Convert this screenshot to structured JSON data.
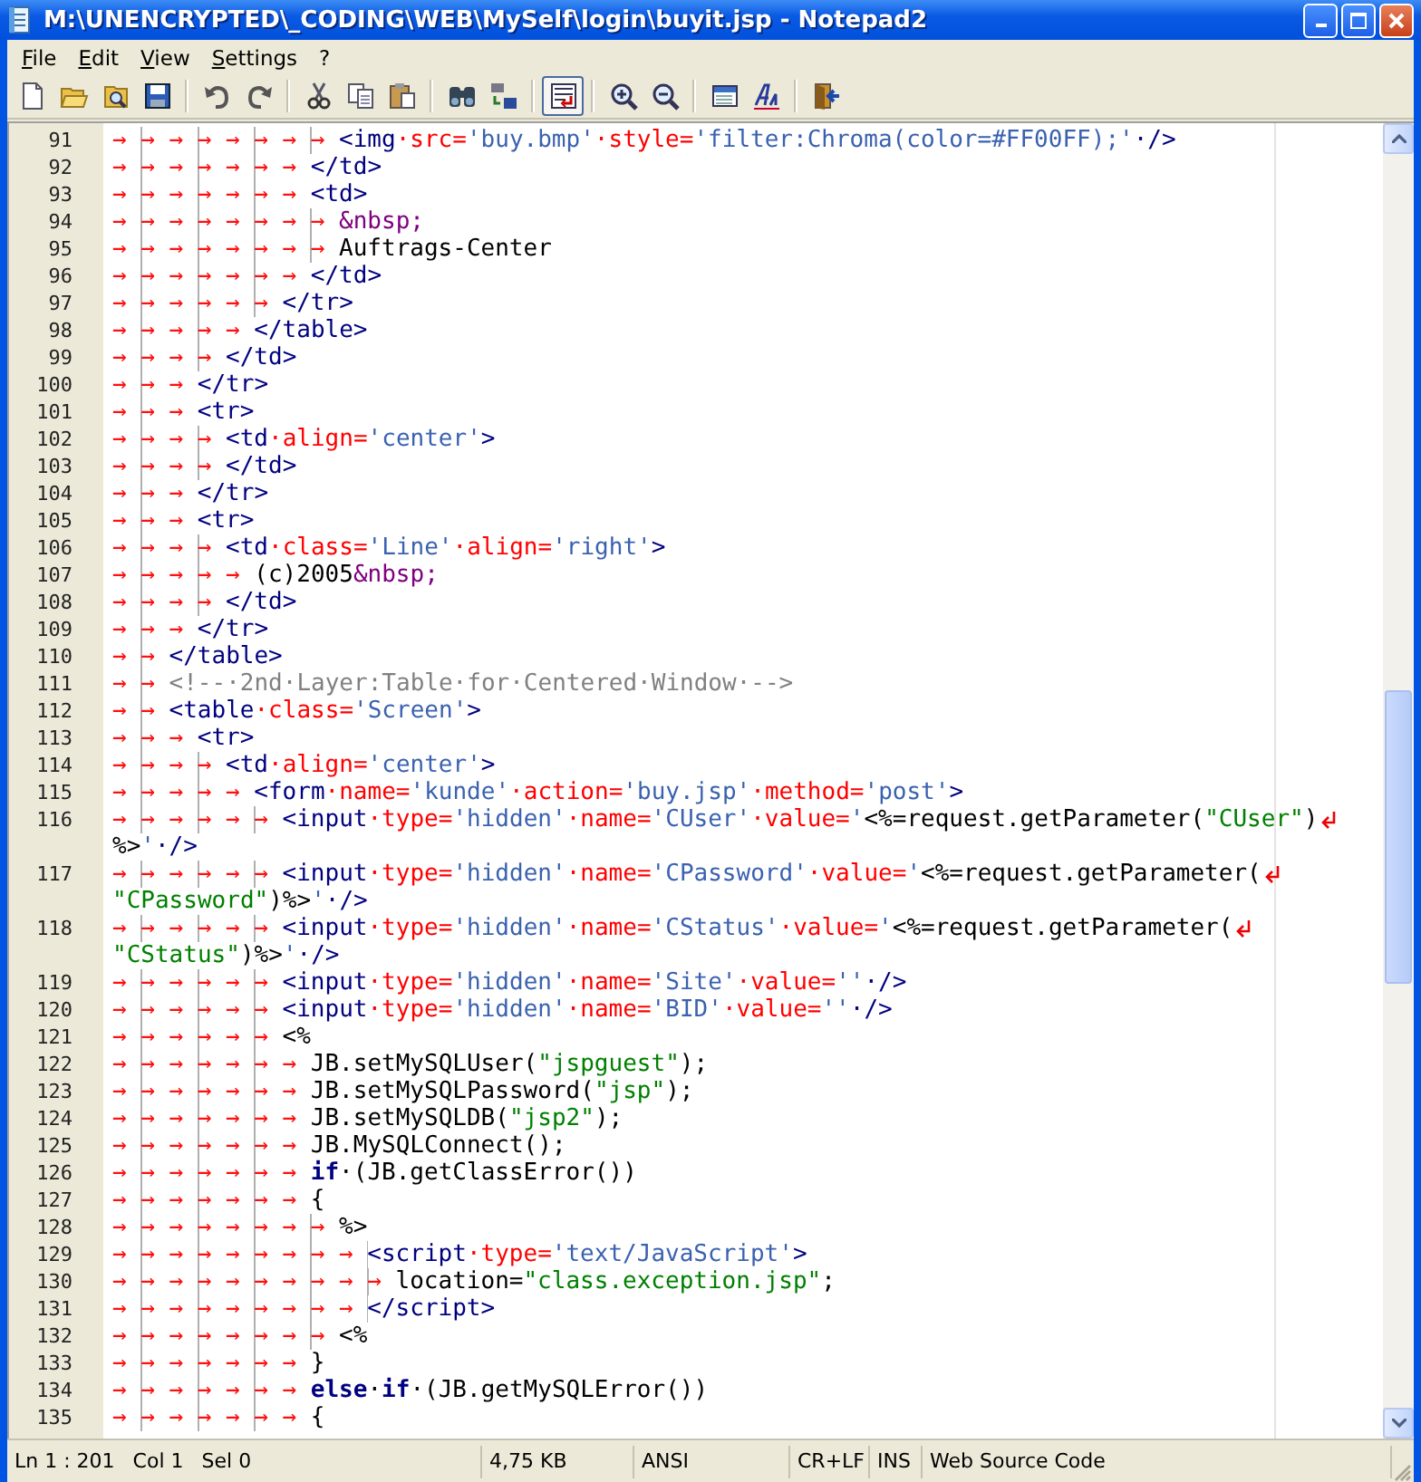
{
  "window": {
    "title": "M:\\UNENCRYPTED\\_CODING\\WEB\\MySelf\\login\\buyit.jsp - Notepad2"
  },
  "menu": [
    "File",
    "Edit",
    "View",
    "Settings",
    "?"
  ],
  "toolbar": {
    "groups": [
      [
        {
          "kind": "new",
          "pressed": false
        },
        {
          "kind": "open",
          "pressed": false
        },
        {
          "kind": "browse",
          "pressed": false
        },
        {
          "kind": "save",
          "pressed": false
        }
      ],
      [
        {
          "kind": "undo",
          "pressed": false
        },
        {
          "kind": "redo",
          "pressed": false
        }
      ],
      [
        {
          "kind": "cut",
          "pressed": false
        },
        {
          "kind": "copy",
          "pressed": false
        },
        {
          "kind": "paste",
          "pressed": false
        }
      ],
      [
        {
          "kind": "find",
          "pressed": false
        },
        {
          "kind": "replace",
          "pressed": false
        }
      ],
      [
        {
          "kind": "wordwrap",
          "pressed": true
        }
      ],
      [
        {
          "kind": "zoomin",
          "pressed": false
        },
        {
          "kind": "zoomout",
          "pressed": false
        }
      ],
      [
        {
          "kind": "scheme",
          "pressed": false
        },
        {
          "kind": "font",
          "pressed": false
        }
      ],
      [
        {
          "kind": "exit",
          "pressed": false
        }
      ]
    ]
  },
  "editor": {
    "lines": [
      {
        "number": "91",
        "indent": "→→→→→→→→",
        "wrapped_parts": [
          [
            {
              "kind": "tag",
              "text": "<img"
            },
            {
              "kind": "attr",
              "text": "·src="
            },
            {
              "kind": "val",
              "text": "'buy.bmp'"
            },
            {
              "kind": "attr",
              "text": "·style="
            },
            {
              "kind": "val",
              "text": "'filter:Chroma(color=#FF00FF);'"
            },
            {
              "kind": "tag",
              "text": "·/>"
            }
          ]
        ]
      },
      {
        "number": "92",
        "indent": "→→→→→→→",
        "wrapped_parts": [
          [
            {
              "kind": "tag",
              "text": "</td>"
            }
          ]
        ]
      },
      {
        "number": "93",
        "indent": "→→→→→→→",
        "wrapped_parts": [
          [
            {
              "kind": "tag",
              "text": "<td>"
            }
          ]
        ]
      },
      {
        "number": "94",
        "indent": "→→→→→→→→",
        "wrapped_parts": [
          [
            {
              "kind": "ent",
              "text": "&nbsp;"
            }
          ]
        ]
      },
      {
        "number": "95",
        "indent": "→→→→→→→→",
        "wrapped_parts": [
          [
            {
              "kind": "text",
              "text": "Auftrags-Center"
            }
          ]
        ]
      },
      {
        "number": "96",
        "indent": "→→→→→→→",
        "wrapped_parts": [
          [
            {
              "kind": "tag",
              "text": "</td>"
            }
          ]
        ]
      },
      {
        "number": "97",
        "indent": "→→→→→→",
        "wrapped_parts": [
          [
            {
              "kind": "tag",
              "text": "</tr>"
            }
          ]
        ]
      },
      {
        "number": "98",
        "indent": "→→→→→",
        "wrapped_parts": [
          [
            {
              "kind": "tag",
              "text": "</table>"
            }
          ]
        ]
      },
      {
        "number": "99",
        "indent": "→→→→",
        "wrapped_parts": [
          [
            {
              "kind": "tag",
              "text": "</td>"
            }
          ]
        ]
      },
      {
        "number": "100",
        "indent": "→→→",
        "wrapped_parts": [
          [
            {
              "kind": "tag",
              "text": "</tr>"
            }
          ]
        ]
      },
      {
        "number": "101",
        "indent": "→→→",
        "wrapped_parts": [
          [
            {
              "kind": "tag",
              "text": "<tr>"
            }
          ]
        ]
      },
      {
        "number": "102",
        "indent": "→→→→",
        "wrapped_parts": [
          [
            {
              "kind": "tag",
              "text": "<td"
            },
            {
              "kind": "attr",
              "text": "·align="
            },
            {
              "kind": "val",
              "text": "'center'"
            },
            {
              "kind": "tag",
              "text": ">"
            }
          ]
        ]
      },
      {
        "number": "103",
        "indent": "→→→→",
        "wrapped_parts": [
          [
            {
              "kind": "tag",
              "text": "</td>"
            }
          ]
        ]
      },
      {
        "number": "104",
        "indent": "→→→",
        "wrapped_parts": [
          [
            {
              "kind": "tag",
              "text": "</tr>"
            }
          ]
        ]
      },
      {
        "number": "105",
        "indent": "→→→",
        "wrapped_parts": [
          [
            {
              "kind": "tag",
              "text": "<tr>"
            }
          ]
        ]
      },
      {
        "number": "106",
        "indent": "→→→→",
        "wrapped_parts": [
          [
            {
              "kind": "tag",
              "text": "<td"
            },
            {
              "kind": "attr",
              "text": "·class="
            },
            {
              "kind": "val",
              "text": "'Line'"
            },
            {
              "kind": "attr",
              "text": "·align="
            },
            {
              "kind": "val",
              "text": "'right'"
            },
            {
              "kind": "tag",
              "text": ">"
            }
          ]
        ]
      },
      {
        "number": "107",
        "indent": "→→→→→",
        "wrapped_parts": [
          [
            {
              "kind": "text",
              "text": "(c)2005"
            },
            {
              "kind": "ent",
              "text": "&nbsp;"
            }
          ]
        ]
      },
      {
        "number": "108",
        "indent": "→→→→",
        "wrapped_parts": [
          [
            {
              "kind": "tag",
              "text": "</td>"
            }
          ]
        ]
      },
      {
        "number": "109",
        "indent": "→→→",
        "wrapped_parts": [
          [
            {
              "kind": "tag",
              "text": "</tr>"
            }
          ]
        ]
      },
      {
        "number": "110",
        "indent": "→→",
        "wrapped_parts": [
          [
            {
              "kind": "tag",
              "text": "</table>"
            }
          ]
        ]
      },
      {
        "number": "111",
        "indent": "→→",
        "wrapped_parts": [
          [
            {
              "kind": "cmt",
              "text": "<!--·2nd·Layer:Table·for·Centered·Window·-->"
            }
          ]
        ]
      },
      {
        "number": "112",
        "indent": "→→",
        "wrapped_parts": [
          [
            {
              "kind": "tag",
              "text": "<table"
            },
            {
              "kind": "attr",
              "text": "·class="
            },
            {
              "kind": "val",
              "text": "'Screen'"
            },
            {
              "kind": "tag",
              "text": ">"
            }
          ]
        ]
      },
      {
        "number": "113",
        "indent": "→→→",
        "wrapped_parts": [
          [
            {
              "kind": "tag",
              "text": "<tr>"
            }
          ]
        ]
      },
      {
        "number": "114",
        "indent": "→→→→",
        "wrapped_parts": [
          [
            {
              "kind": "tag",
              "text": "<td"
            },
            {
              "kind": "attr",
              "text": "·align="
            },
            {
              "kind": "val",
              "text": "'center'"
            },
            {
              "kind": "tag",
              "text": ">"
            }
          ]
        ]
      },
      {
        "number": "115",
        "indent": "→→→→→",
        "wrapped_parts": [
          [
            {
              "kind": "tag",
              "text": "<form"
            },
            {
              "kind": "attr",
              "text": "·name="
            },
            {
              "kind": "val",
              "text": "'kunde'"
            },
            {
              "kind": "attr",
              "text": "·action="
            },
            {
              "kind": "val",
              "text": "'buy.jsp'"
            },
            {
              "kind": "attr",
              "text": "·method="
            },
            {
              "kind": "val",
              "text": "'post'"
            },
            {
              "kind": "tag",
              "text": ">"
            }
          ]
        ]
      },
      {
        "number": "116",
        "indent": "→→→→→→",
        "wrapped_parts": [
          [
            {
              "kind": "tag",
              "text": "<input"
            },
            {
              "kind": "attr",
              "text": "·type="
            },
            {
              "kind": "val",
              "text": "'hidden'"
            },
            {
              "kind": "attr",
              "text": "·name="
            },
            {
              "kind": "val",
              "text": "'CUser'"
            },
            {
              "kind": "attr",
              "text": "·value="
            },
            {
              "kind": "val",
              "text": "'"
            },
            {
              "kind": "text",
              "text": "<%=request.getParameter("
            },
            {
              "kind": "str",
              "text": "\"CUser\""
            },
            {
              "kind": "text",
              "text": ")"
            }
          ],
          [
            {
              "kind": "text",
              "text": "%>"
            },
            {
              "kind": "val",
              "text": "'"
            },
            {
              "kind": "tag",
              "text": "·/>"
            }
          ]
        ]
      },
      {
        "number": "117",
        "indent": "→→→→→→",
        "wrapped_parts": [
          [
            {
              "kind": "tag",
              "text": "<input"
            },
            {
              "kind": "attr",
              "text": "·type="
            },
            {
              "kind": "val",
              "text": "'hidden'"
            },
            {
              "kind": "attr",
              "text": "·name="
            },
            {
              "kind": "val",
              "text": "'CPassword'"
            },
            {
              "kind": "attr",
              "text": "·value="
            },
            {
              "kind": "val",
              "text": "'"
            },
            {
              "kind": "text",
              "text": "<%=request.getParameter("
            }
          ],
          [
            {
              "kind": "str",
              "text": "\"CPassword\""
            },
            {
              "kind": "text",
              "text": ")%>"
            },
            {
              "kind": "val",
              "text": "'"
            },
            {
              "kind": "tag",
              "text": "·/>"
            }
          ]
        ]
      },
      {
        "number": "118",
        "indent": "→→→→→→",
        "wrapped_parts": [
          [
            {
              "kind": "tag",
              "text": "<input"
            },
            {
              "kind": "attr",
              "text": "·type="
            },
            {
              "kind": "val",
              "text": "'hidden'"
            },
            {
              "kind": "attr",
              "text": "·name="
            },
            {
              "kind": "val",
              "text": "'CStatus'"
            },
            {
              "kind": "attr",
              "text": "·value="
            },
            {
              "kind": "val",
              "text": "'"
            },
            {
              "kind": "text",
              "text": "<%=request.getParameter("
            }
          ],
          [
            {
              "kind": "str",
              "text": "\"CStatus\""
            },
            {
              "kind": "text",
              "text": ")%>"
            },
            {
              "kind": "val",
              "text": "'"
            },
            {
              "kind": "tag",
              "text": "·/>"
            }
          ]
        ]
      },
      {
        "number": "119",
        "indent": "→→→→→→",
        "wrapped_parts": [
          [
            {
              "kind": "tag",
              "text": "<input"
            },
            {
              "kind": "attr",
              "text": "·type="
            },
            {
              "kind": "val",
              "text": "'hidden'"
            },
            {
              "kind": "attr",
              "text": "·name="
            },
            {
              "kind": "val",
              "text": "'Site'"
            },
            {
              "kind": "attr",
              "text": "·value="
            },
            {
              "kind": "val",
              "text": "''"
            },
            {
              "kind": "tag",
              "text": "·/>"
            }
          ]
        ]
      },
      {
        "number": "120",
        "indent": "→→→→→→",
        "wrapped_parts": [
          [
            {
              "kind": "tag",
              "text": "<input"
            },
            {
              "kind": "attr",
              "text": "·type="
            },
            {
              "kind": "val",
              "text": "'hidden'"
            },
            {
              "kind": "attr",
              "text": "·name="
            },
            {
              "kind": "val",
              "text": "'BID'"
            },
            {
              "kind": "attr",
              "text": "·value="
            },
            {
              "kind": "val",
              "text": "''"
            },
            {
              "kind": "tag",
              "text": "·/>"
            }
          ]
        ]
      },
      {
        "number": "121",
        "indent": "→→→→→→",
        "wrapped_parts": [
          [
            {
              "kind": "text",
              "text": "<%"
            }
          ]
        ]
      },
      {
        "number": "122",
        "indent": "→→→→→→→",
        "wrapped_parts": [
          [
            {
              "kind": "text",
              "text": "JB.setMySQLUser("
            },
            {
              "kind": "str",
              "text": "\"jspguest\""
            },
            {
              "kind": "text",
              "text": ");"
            }
          ]
        ]
      },
      {
        "number": "123",
        "indent": "→→→→→→→",
        "wrapped_parts": [
          [
            {
              "kind": "text",
              "text": "JB.setMySQLPassword("
            },
            {
              "kind": "str",
              "text": "\"jsp\""
            },
            {
              "kind": "text",
              "text": ");"
            }
          ]
        ]
      },
      {
        "number": "124",
        "indent": "→→→→→→→",
        "wrapped_parts": [
          [
            {
              "kind": "text",
              "text": "JB.setMySQLDB("
            },
            {
              "kind": "str",
              "text": "\"jsp2\""
            },
            {
              "kind": "text",
              "text": ");"
            }
          ]
        ]
      },
      {
        "number": "125",
        "indent": "→→→→→→→",
        "wrapped_parts": [
          [
            {
              "kind": "text",
              "text": "JB.MySQLConnect();"
            }
          ]
        ]
      },
      {
        "number": "126",
        "indent": "→→→→→→→",
        "wrapped_parts": [
          [
            {
              "kind": "kw",
              "text": "if"
            },
            {
              "kind": "text",
              "text": "·(JB.getClassError())"
            }
          ]
        ]
      },
      {
        "number": "127",
        "indent": "→→→→→→→",
        "wrapped_parts": [
          [
            {
              "kind": "text",
              "text": "{"
            }
          ]
        ]
      },
      {
        "number": "128",
        "indent": "→→→→→→→→",
        "wrapped_parts": [
          [
            {
              "kind": "text",
              "text": "%>"
            }
          ]
        ]
      },
      {
        "number": "129",
        "indent": "→→→→→→→→→",
        "wrapped_parts": [
          [
            {
              "kind": "tag",
              "text": "<script"
            },
            {
              "kind": "attr",
              "text": "·type="
            },
            {
              "kind": "val",
              "text": "'text/JavaScript'"
            },
            {
              "kind": "tag",
              "text": ">"
            }
          ]
        ]
      },
      {
        "number": "130",
        "indent": "→→→→→→→→→→",
        "wrapped_parts": [
          [
            {
              "kind": "text",
              "text": "location="
            },
            {
              "kind": "str",
              "text": "\"class.exception.jsp\""
            },
            {
              "kind": "text",
              "text": ";"
            }
          ]
        ]
      },
      {
        "number": "131",
        "indent": "→→→→→→→→→",
        "wrapped_parts": [
          [
            {
              "kind": "tag",
              "text": "</script>"
            }
          ]
        ]
      },
      {
        "number": "132",
        "indent": "→→→→→→→→",
        "wrapped_parts": [
          [
            {
              "kind": "text",
              "text": "<%"
            }
          ]
        ]
      },
      {
        "number": "133",
        "indent": "→→→→→→→",
        "wrapped_parts": [
          [
            {
              "kind": "text",
              "text": "}"
            }
          ]
        ]
      },
      {
        "number": "134",
        "indent": "→→→→→→→",
        "wrapped_parts": [
          [
            {
              "kind": "kw",
              "text": "else"
            },
            {
              "kind": "text",
              "text": "·"
            },
            {
              "kind": "kw",
              "text": "if"
            },
            {
              "kind": "text",
              "text": "·(JB.getMySQLError())"
            }
          ]
        ]
      },
      {
        "number": "135",
        "indent": "→→→→→→→",
        "wrapped_parts": [
          [
            {
              "kind": "text",
              "text": "{"
            }
          ]
        ]
      }
    ]
  },
  "status_bar": {
    "panels": [
      [
        "Ln 1 : 201",
        "Col 1",
        "Sel 0"
      ],
      [
        "4,75 KB"
      ],
      [
        "ANSI"
      ],
      [
        "CR+LF"
      ],
      [
        "INS"
      ],
      [
        "Web Source Code"
      ]
    ]
  }
}
